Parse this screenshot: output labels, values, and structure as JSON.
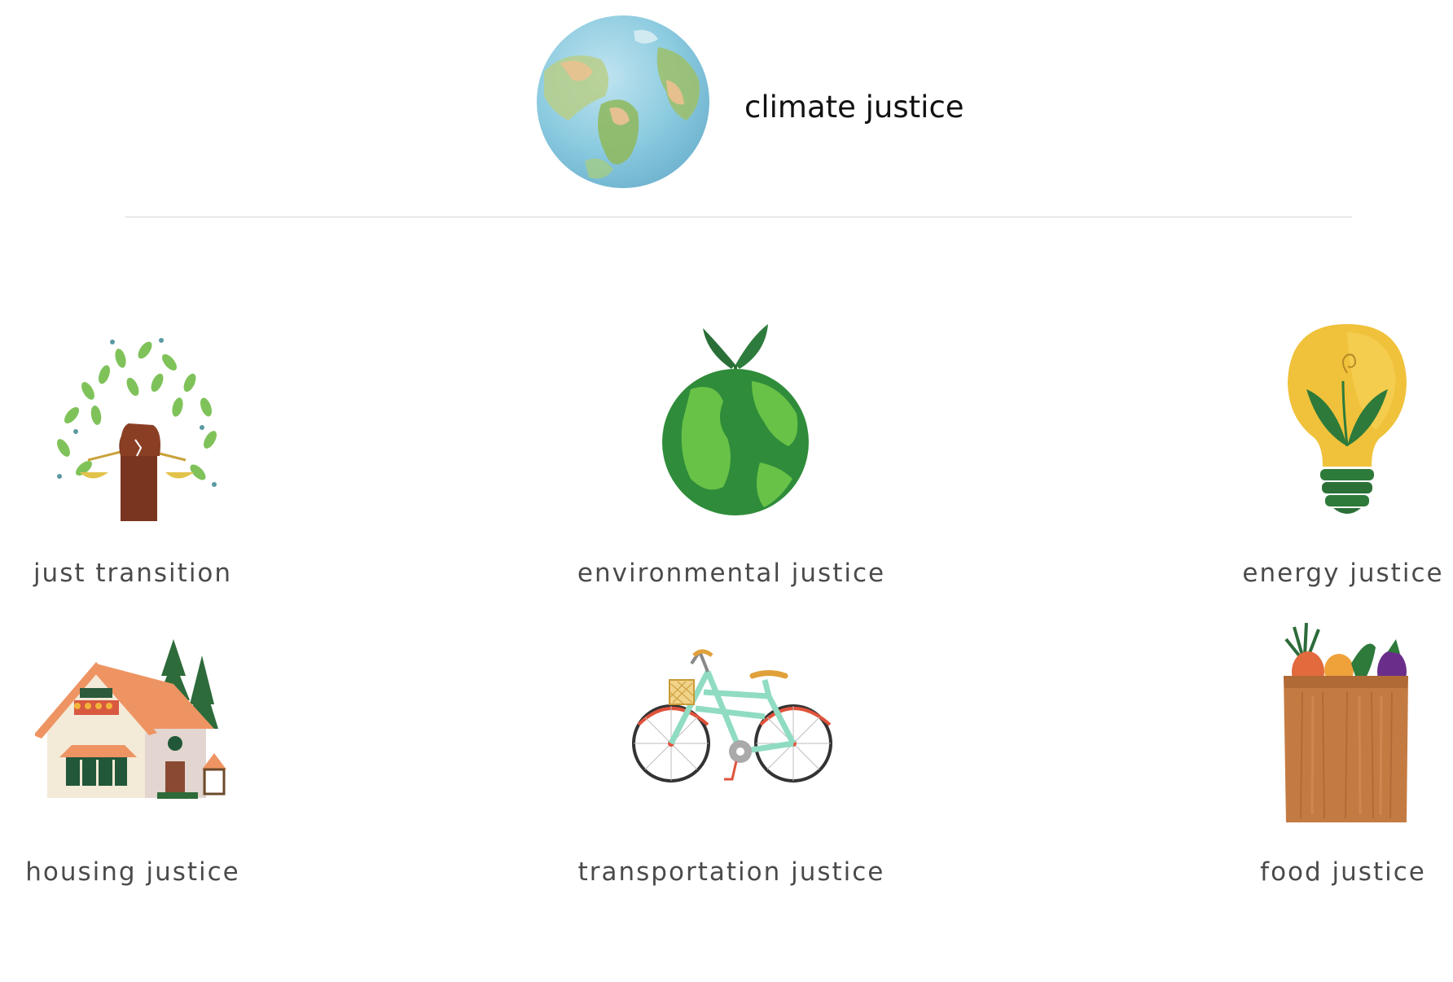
{
  "header": {
    "title": "climate justice",
    "icon": "watercolor-globe-icon"
  },
  "topics": [
    {
      "label": "just transition",
      "icon": "raised-fist-tree-icon"
    },
    {
      "label": "environmental justice",
      "icon": "green-earth-sprout-icon"
    },
    {
      "label": "energy justice",
      "icon": "lightbulb-leaves-icon"
    },
    {
      "label": "housing justice",
      "icon": "house-icon"
    },
    {
      "label": "transportation justice",
      "icon": "bicycle-icon"
    },
    {
      "label": "food justice",
      "icon": "grocery-bag-icon"
    }
  ],
  "colors": {
    "title": "#111111",
    "label": "#4a4a4a",
    "divider": "#d6d6d6"
  }
}
